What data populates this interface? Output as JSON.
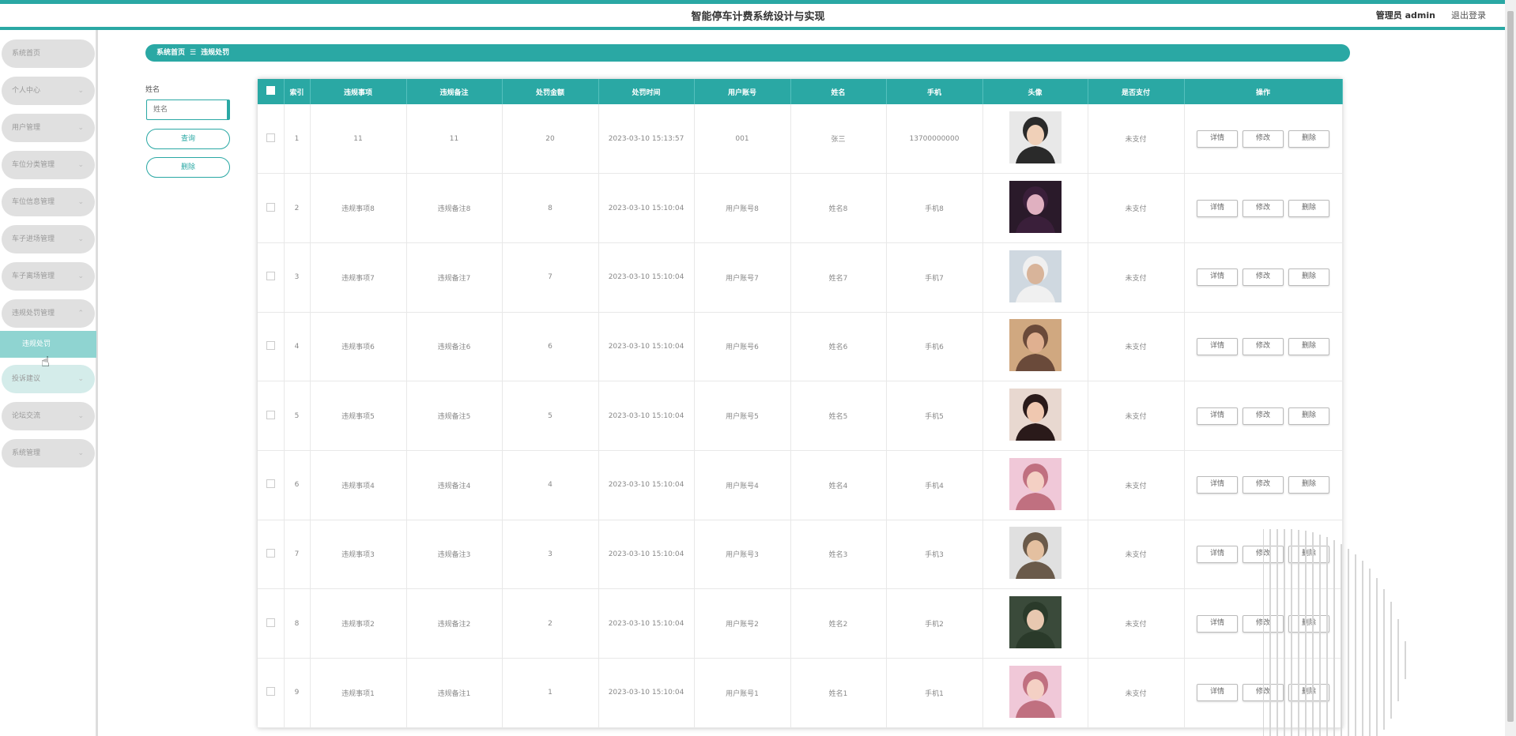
{
  "header": {
    "title": "智能停车计费系统设计与实现",
    "admin_label": "管理员 admin",
    "logout_label": "退出登录"
  },
  "sidebar": {
    "items": [
      {
        "label": "系统首页",
        "chevron": false
      },
      {
        "label": "个人中心",
        "chevron": true
      },
      {
        "label": "用户管理",
        "chevron": true
      },
      {
        "label": "车位分类管理",
        "chevron": true
      },
      {
        "label": "车位信息管理",
        "chevron": true
      },
      {
        "label": "车子进场管理",
        "chevron": true
      },
      {
        "label": "车子离场管理",
        "chevron": true
      },
      {
        "label": "违规处罚管理",
        "chevron": true
      },
      {
        "label": "投诉建议",
        "chevron": true
      },
      {
        "label": "论坛交流",
        "chevron": true
      },
      {
        "label": "系统管理",
        "chevron": true
      }
    ],
    "active_sub": "违规处罚"
  },
  "breadcrumb": {
    "home": "系统首页",
    "current": "违规处罚"
  },
  "search": {
    "label": "姓名",
    "placeholder": "姓名",
    "query_button": "查询",
    "delete_button": "删除"
  },
  "table": {
    "headers": [
      "索引",
      "违规事项",
      "违规备注",
      "处罚金额",
      "处罚时间",
      "用户账号",
      "姓名",
      "手机",
      "头像",
      "是否支付",
      "操作"
    ],
    "actions": {
      "detail": "详情",
      "edit": "修改",
      "delete": "删除"
    },
    "rows": [
      {
        "index": "1",
        "item": "11",
        "note": "11",
        "amount": "20",
        "time": "2023-03-10 15:13:57",
        "account": "001",
        "name": "张三",
        "phone": "13700000000",
        "paid": "未支付"
      },
      {
        "index": "2",
        "item": "违规事项8",
        "note": "违规备注8",
        "amount": "8",
        "time": "2023-03-10 15:10:04",
        "account": "用户账号8",
        "name": "姓名8",
        "phone": "手机8",
        "paid": "未支付"
      },
      {
        "index": "3",
        "item": "违规事项7",
        "note": "违规备注7",
        "amount": "7",
        "time": "2023-03-10 15:10:04",
        "account": "用户账号7",
        "name": "姓名7",
        "phone": "手机7",
        "paid": "未支付"
      },
      {
        "index": "4",
        "item": "违规事项6",
        "note": "违规备注6",
        "amount": "6",
        "time": "2023-03-10 15:10:04",
        "account": "用户账号6",
        "name": "姓名6",
        "phone": "手机6",
        "paid": "未支付"
      },
      {
        "index": "5",
        "item": "违规事项5",
        "note": "违规备注5",
        "amount": "5",
        "time": "2023-03-10 15:10:04",
        "account": "用户账号5",
        "name": "姓名5",
        "phone": "手机5",
        "paid": "未支付"
      },
      {
        "index": "6",
        "item": "违规事项4",
        "note": "违规备注4",
        "amount": "4",
        "time": "2023-03-10 15:10:04",
        "account": "用户账号4",
        "name": "姓名4",
        "phone": "手机4",
        "paid": "未支付"
      },
      {
        "index": "7",
        "item": "违规事项3",
        "note": "违规备注3",
        "amount": "3",
        "time": "2023-03-10 15:10:04",
        "account": "用户账号3",
        "name": "姓名3",
        "phone": "手机3",
        "paid": "未支付"
      },
      {
        "index": "8",
        "item": "违规事项2",
        "note": "违规备注2",
        "amount": "2",
        "time": "2023-03-10 15:10:04",
        "account": "用户账号2",
        "name": "姓名2",
        "phone": "手机2",
        "paid": "未支付"
      },
      {
        "index": "9",
        "item": "违规事项1",
        "note": "违规备注1",
        "amount": "1",
        "time": "2023-03-10 15:10:04",
        "account": "用户账号1",
        "name": "姓名1",
        "phone": "手机1",
        "paid": "未支付"
      }
    ]
  },
  "colors": {
    "accent": "#2aa8a4",
    "active_nav": "#8fd4d1",
    "nav_bg": "#e0e0e0"
  }
}
